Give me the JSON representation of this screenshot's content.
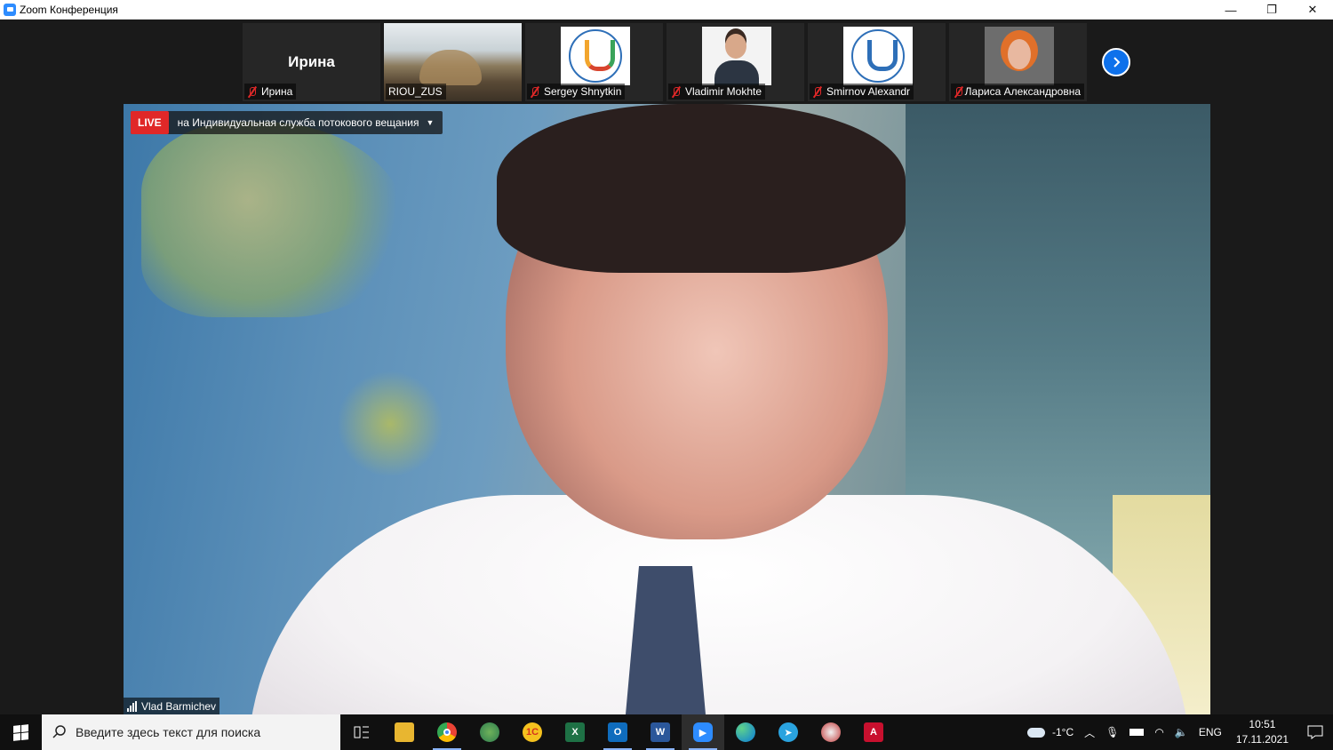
{
  "window": {
    "title": "Zoom Конференция",
    "controls": {
      "minimize": "—",
      "restore": "❐",
      "close": "✕"
    }
  },
  "participants": [
    {
      "display": "Ирина",
      "name": "Ирина",
      "muted": true,
      "video": "none"
    },
    {
      "name": "RIOU_ZUS",
      "muted": false,
      "video": "room"
    },
    {
      "name": "Sergey Shnytkin",
      "muted": true,
      "video": "logo-color"
    },
    {
      "name": "Vladimir Mokhte",
      "muted": true,
      "video": "man"
    },
    {
      "name": "Smirnov Alexandr",
      "muted": true,
      "video": "logo-blue"
    },
    {
      "name": "Лариса Александровна",
      "muted": true,
      "video": "woman"
    }
  ],
  "live": {
    "badge": "LIVE",
    "text": "на Индивидуальная служба потокового вещания",
    "badge_color": "#e02828"
  },
  "active_speaker": {
    "name": "Vlad Barmichev"
  },
  "taskbar": {
    "search_placeholder": "Введите здесь текст для поиска",
    "apps": [
      "task-view",
      "file-explorer",
      "chrome",
      "maps",
      "yandex",
      "excel",
      "outlook",
      "word",
      "zoom",
      "edge",
      "telegram",
      "mission",
      "acrobat"
    ],
    "weather": "-1°C",
    "language": "ENG",
    "time": "10:51",
    "date": "17.11.2021"
  },
  "colors": {
    "zoom_blue": "#2d8cff",
    "next_button": "#0e71eb",
    "mute_red": "#e02828"
  }
}
